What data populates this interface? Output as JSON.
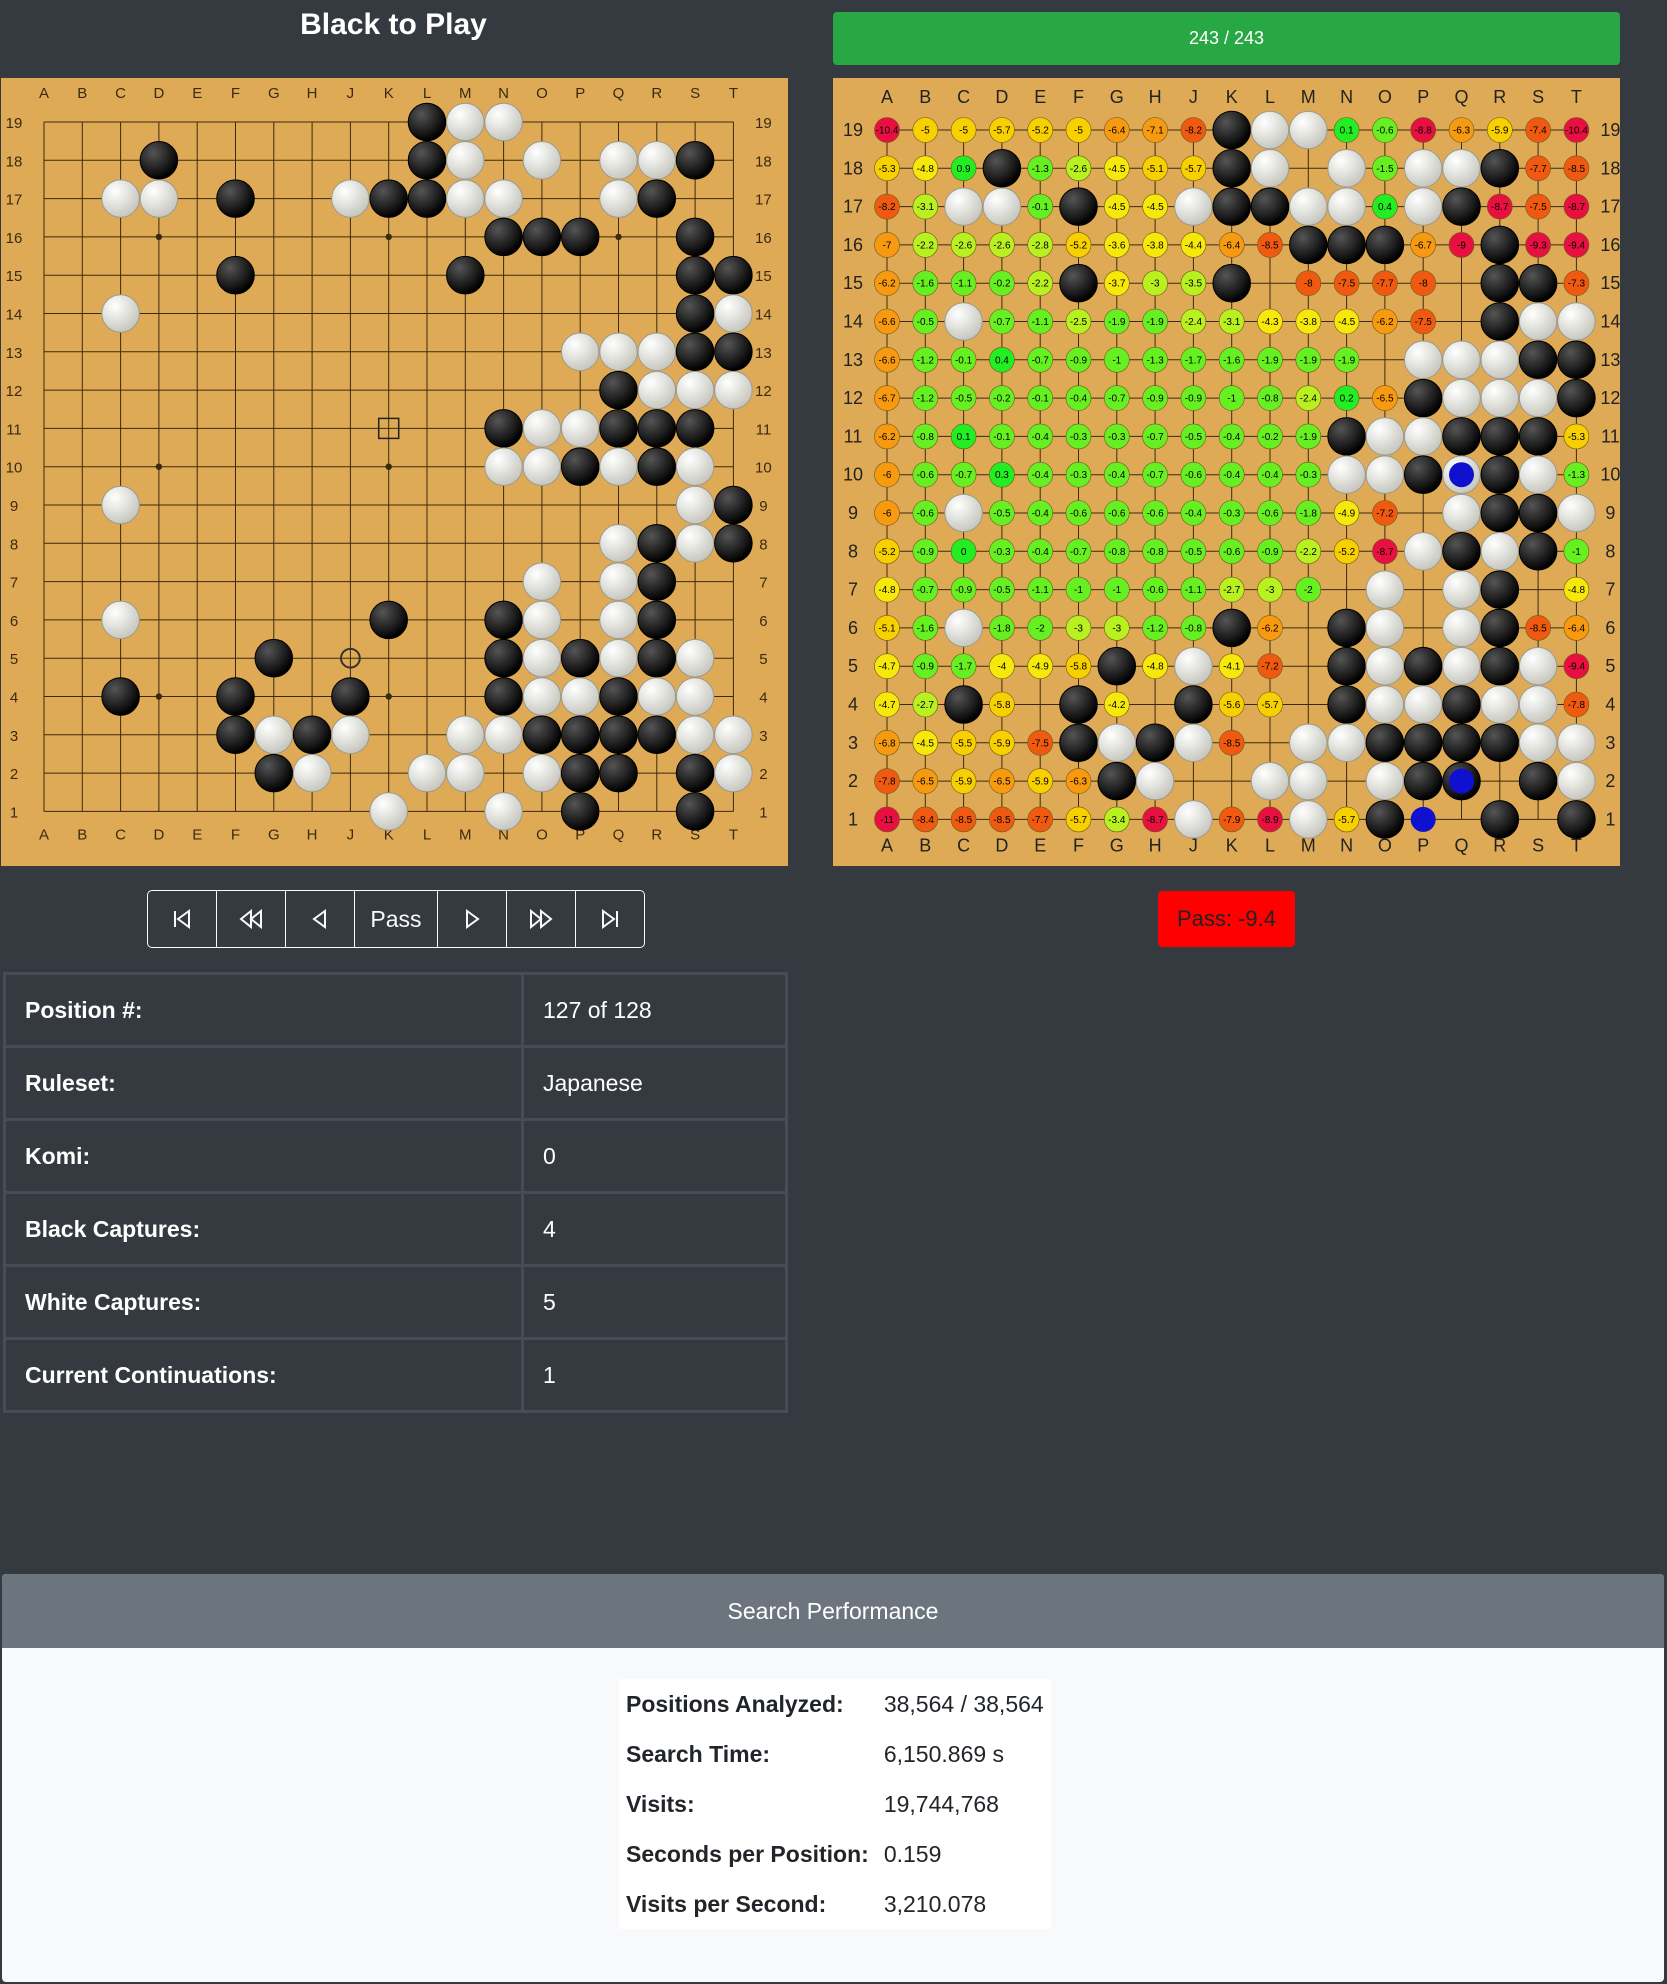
{
  "left_title": "Black to Play",
  "progress_label": "243 / 243",
  "progress_fraction": 1.0,
  "col_labels": [
    "A",
    "B",
    "C",
    "D",
    "E",
    "F",
    "G",
    "H",
    "J",
    "K",
    "L",
    "M",
    "N",
    "O",
    "P",
    "Q",
    "R",
    "S",
    "T"
  ],
  "row_labels": [
    "19",
    "18",
    "17",
    "16",
    "15",
    "14",
    "13",
    "12",
    "11",
    "10",
    "9",
    "8",
    "7",
    "6",
    "5",
    "4",
    "3",
    "2",
    "1"
  ],
  "board_left": {
    "stones": [
      "..........BWW......",
      "...B......BW.W.WWB.",
      "..WW.B..WBBWW..WB..",
      "............BBB..B.",
      ".....B.....B.....BB",
      "..W..............BWW",
      "..............WWWBBB",
      "...............BWWWB",
      "............BWWBBB.",
      "............WWBWBW.",
      "..W..............WBBW",
      "...............WBWB",
      ".............W.WB..",
      "..W......B..BW.WB..",
      "......B.....BWBWBW.",
      "..B..B..B...BWWBWW.",
      ".....BWBW..WWBBBBWW",
      "......BW..WW.WBB.BW",
      ".........W..W.B..B.B"
    ],
    "last_move": "J5",
    "square_marker": "K11"
  },
  "board_right": {
    "stones": [
      ".........BWW.......",
      "...B.....BW.W.WWB..",
      "..WW.B..WBBWW.WB...",
      "...........BBB..B..",
      ".....B...B......BB.",
      "..W.............BWW.",
      "..............WWWBBB",
      "..............BWWWB",
      "............BWWBBB.",
      "............WWBWBW.",
      "..W............WBBW",
      "..............WBWB.",
      ".............W.WB..",
      "..W......B..BW.WB..",
      "......B.W...BWBWBW.",
      "..B..B..B...BWWBWW.",
      ".....BWBW..WWBBBBWW",
      "......BW..WW.WBB.BW",
      "........W..W.B..B.B"
    ],
    "highlight_stones": [
      "C18",
      "D13",
      "O17"
    ],
    "blue_points": [
      "Q10",
      "Q2",
      "P1"
    ],
    "values": {
      "A19": "-10.4",
      "B19": "-5",
      "C19": "-5",
      "D19": "-5.7",
      "E19": "-5.2",
      "F19": "-5",
      "G19": "-6.4",
      "H19": "-7.1",
      "J19": "-8.2",
      "N19": "0.1",
      "O19": "-0.6",
      "P19": "-8.8",
      "Q19": "-6.3",
      "R19": "-5.9",
      "S19": "-7.4",
      "T19": "-10.4",
      "A18": "-5.3",
      "B18": "-4.8",
      "C18": "0.9",
      "E18": "-1.3",
      "F18": "-2.6",
      "G18": "-4.5",
      "H18": "-5.1",
      "J18": "-5.7",
      "M18": "",
      "O18": "-1.5",
      "S18": "-7.7",
      "T18": "-8.5",
      "A17": "-8.2",
      "B17": "-3.1",
      "E17": "-0.1",
      "G17": "-4.5",
      "H17": "-4.5",
      "O17": "0.4",
      "R17": "-8.7",
      "S17": "-7.5",
      "T17": "-8.7",
      "A16": "-7",
      "B16": "-2.2",
      "C16": "-2.6",
      "D16": "-2.6",
      "E16": "-2.8",
      "F16": "-5.2",
      "G16": "-3.6",
      "H16": "-3.8",
      "J16": "-4.4",
      "K16": "-6.4",
      "L16": "-8.5",
      "P16": "-6.7",
      "Q16": "-9",
      "S16": "-9.3",
      "T16": "-9.4",
      "A15": "-6.2",
      "B15": "-1.6",
      "C15": "-1.1",
      "D15": "-0.2",
      "E15": "-2.2",
      "G15": "-3.7",
      "H15": "-3",
      "J15": "-3.5",
      "K15": "-5.1",
      "M15": "-8",
      "N15": "-7.5",
      "O15": "-7.7",
      "P15": "-8",
      "S15": "-6.7",
      "T15": "-7.3",
      "A14": "-6.6",
      "B14": "-0.5",
      "D14": "-0.7",
      "E14": "-1.1",
      "F14": "-2.5",
      "G14": "-1.9",
      "H14": "-1.9",
      "J14": "-2.4",
      "K14": "-3.1",
      "L14": "-4.3",
      "M14": "-3.8",
      "N14": "-4.5",
      "O14": "-6.2",
      "P14": "-7.5",
      "T14": "-6.7",
      "A13": "-6.6",
      "B13": "-1.2",
      "C13": "-0.1",
      "D13": "0.4",
      "E13": "-0.7",
      "F13": "-0.9",
      "G13": "-1",
      "H13": "-1.3",
      "J13": "-1.7",
      "K13": "-1.6",
      "L13": "-1.9",
      "M13": "-1.9",
      "N13": "-1.9",
      "A12": "-6.7",
      "B12": "-1.2",
      "C12": "-0.5",
      "D12": "-0.2",
      "E12": "-0.1",
      "F12": "-0.4",
      "G12": "-0.7",
      "H12": "-0.9",
      "J12": "-0.9",
      "K12": "-1",
      "L12": "-0.8",
      "M12": "-2.4",
      "N12": "0.2",
      "O12": "-6.5",
      "A11": "-6.2",
      "B11": "-0.8",
      "C11": "0.1",
      "D11": "-0.1",
      "E11": "-0.4",
      "F11": "-0.3",
      "G11": "-0.3",
      "H11": "-0.7",
      "J11": "-0.5",
      "K11": "-0.4",
      "L11": "-0.2",
      "M11": "-1.9",
      "T11": "-5.3",
      "A10": "-6",
      "B10": "-0.6",
      "C10": "-0.7",
      "D10": "0.3",
      "E10": "-0.4",
      "F10": "-0.3",
      "G10": "-0.4",
      "H10": "-0.7",
      "J10": "-0.6",
      "K10": "-0.4",
      "L10": "-0.4",
      "M10": "-0.3",
      "Q10": "",
      "T10": "-1.3",
      "A9": "-6",
      "B9": "-0.6",
      "D9": "-0.5",
      "E9": "-0.4",
      "F9": "-0.6",
      "G9": "-0.6",
      "H9": "-0.6",
      "J9": "-0.4",
      "K9": "-0.3",
      "L9": "-0.6",
      "M9": "-1.8",
      "N9": "-4.9",
      "O9": "-7.2",
      "T9": "-3.4",
      "A8": "-5.2",
      "B8": "-0.9",
      "C8": "0",
      "D8": "-0.3",
      "E8": "-0.4",
      "F8": "-0.7",
      "G8": "-0.8",
      "H8": "-0.8",
      "J8": "-0.5",
      "K8": "-0.6",
      "L8": "-0.9",
      "M8": "-2.2",
      "N8": "-5.2",
      "O8": "-8.7",
      "T8": "-1",
      "A7": "-4.8",
      "B7": "-0.7",
      "C7": "-0.9",
      "D7": "-0.5",
      "E7": "-1.1",
      "F7": "-1",
      "G7": "-1",
      "H7": "-0.6",
      "J7": "-1.1",
      "K7": "-2.7",
      "L7": "-3",
      "M7": "-2",
      "O7": "-7.6",
      "T7": "-4.8",
      "A6": "-5.1",
      "B6": "-1.6",
      "D6": "-1.8",
      "E6": "-2",
      "F6": "-3",
      "G6": "-3",
      "H6": "-1.2",
      "J6": "-0.8",
      "L6": "-6.2",
      "O6": "-7.7",
      "R6": "-4.5",
      "S6": "-8.5",
      "T6": "-6.4",
      "A5": "-4.7",
      "B5": "-0.9",
      "C5": "-1.7",
      "D5": "-4",
      "E5": "-4.9",
      "F5": "-5.8",
      "H5": "-4.8",
      "K5": "-4.1",
      "L5": "-7.2",
      "S5": "-6.9",
      "T5": "-9.4",
      "A4": "-4.7",
      "B4": "-2.7",
      "D4": "-5.8",
      "F4": "-7.9",
      "G4": "-4.2",
      "J4": "0.3",
      "K4": "-5.6",
      "L4": "-5.7",
      "S4": "-10",
      "T4": "-7.8",
      "A3": "-6.8",
      "B3": "-4.5",
      "C3": "-5.5",
      "D3": "-5.9",
      "E3": "-7.5",
      "K3": "-8.5",
      "T3": "-9.1",
      "A2": "-7.8",
      "B2": "-6.5",
      "C2": "-5.9",
      "D2": "-6.5",
      "E2": "-5.9",
      "F2": "-6.3",
      "T2": "-7.2",
      "A1": "-11",
      "B1": "-8.4",
      "C1": "-8.5",
      "D1": "-8.5",
      "E1": "-7.7",
      "F1": "-5.7",
      "G1": "-3.4",
      "H1": "-8.7",
      "K1": "-7.9",
      "L1": "-8.9",
      "N1": "-5.7",
      "R1": "-8.4",
      "T1": "-9.2"
    }
  },
  "nav_buttons": [
    {
      "name": "first-position-button",
      "icon": "skip-to-start-icon",
      "glyph": "⏮"
    },
    {
      "name": "back-fast-button",
      "icon": "double-left-icon",
      "glyph": "«"
    },
    {
      "name": "back-button",
      "icon": "triangle-left-icon",
      "glyph": "◁"
    },
    {
      "name": "pass-button",
      "label": "Pass"
    },
    {
      "name": "forward-button",
      "icon": "triangle-right-icon",
      "glyph": "▷"
    },
    {
      "name": "forward-fast-button",
      "icon": "double-right-icon",
      "glyph": "»"
    },
    {
      "name": "last-position-button",
      "icon": "skip-to-end-icon",
      "glyph": "⏭"
    }
  ],
  "pass_value": "Pass: -9.4",
  "info_rows": [
    {
      "key": "Position #:",
      "value": "127 of 128"
    },
    {
      "key": "Ruleset:",
      "value": "Japanese"
    },
    {
      "key": "Komi:",
      "value": "0"
    },
    {
      "key": "Black Captures:",
      "value": "4"
    },
    {
      "key": "White Captures:",
      "value": "5"
    },
    {
      "key": "Current Continuations:",
      "value": "1"
    }
  ],
  "perf_title": "Search Performance",
  "perf_rows": [
    {
      "key": "Positions Analyzed:",
      "value": "38,564 / 38,564"
    },
    {
      "key": "Search Time:",
      "value": "6,150.869 s"
    },
    {
      "key": "Visits:",
      "value": "19,744,768"
    },
    {
      "key": "Seconds per Position:",
      "value": "0.159"
    },
    {
      "key": "Visits per Second:",
      "value": "3,210.078"
    }
  ],
  "colors": {
    "board": "#deaa55",
    "progress": "#28a745",
    "pass_badge": "#ff0000",
    "highlight": "#00e600",
    "blue_point": "#1010d0"
  }
}
